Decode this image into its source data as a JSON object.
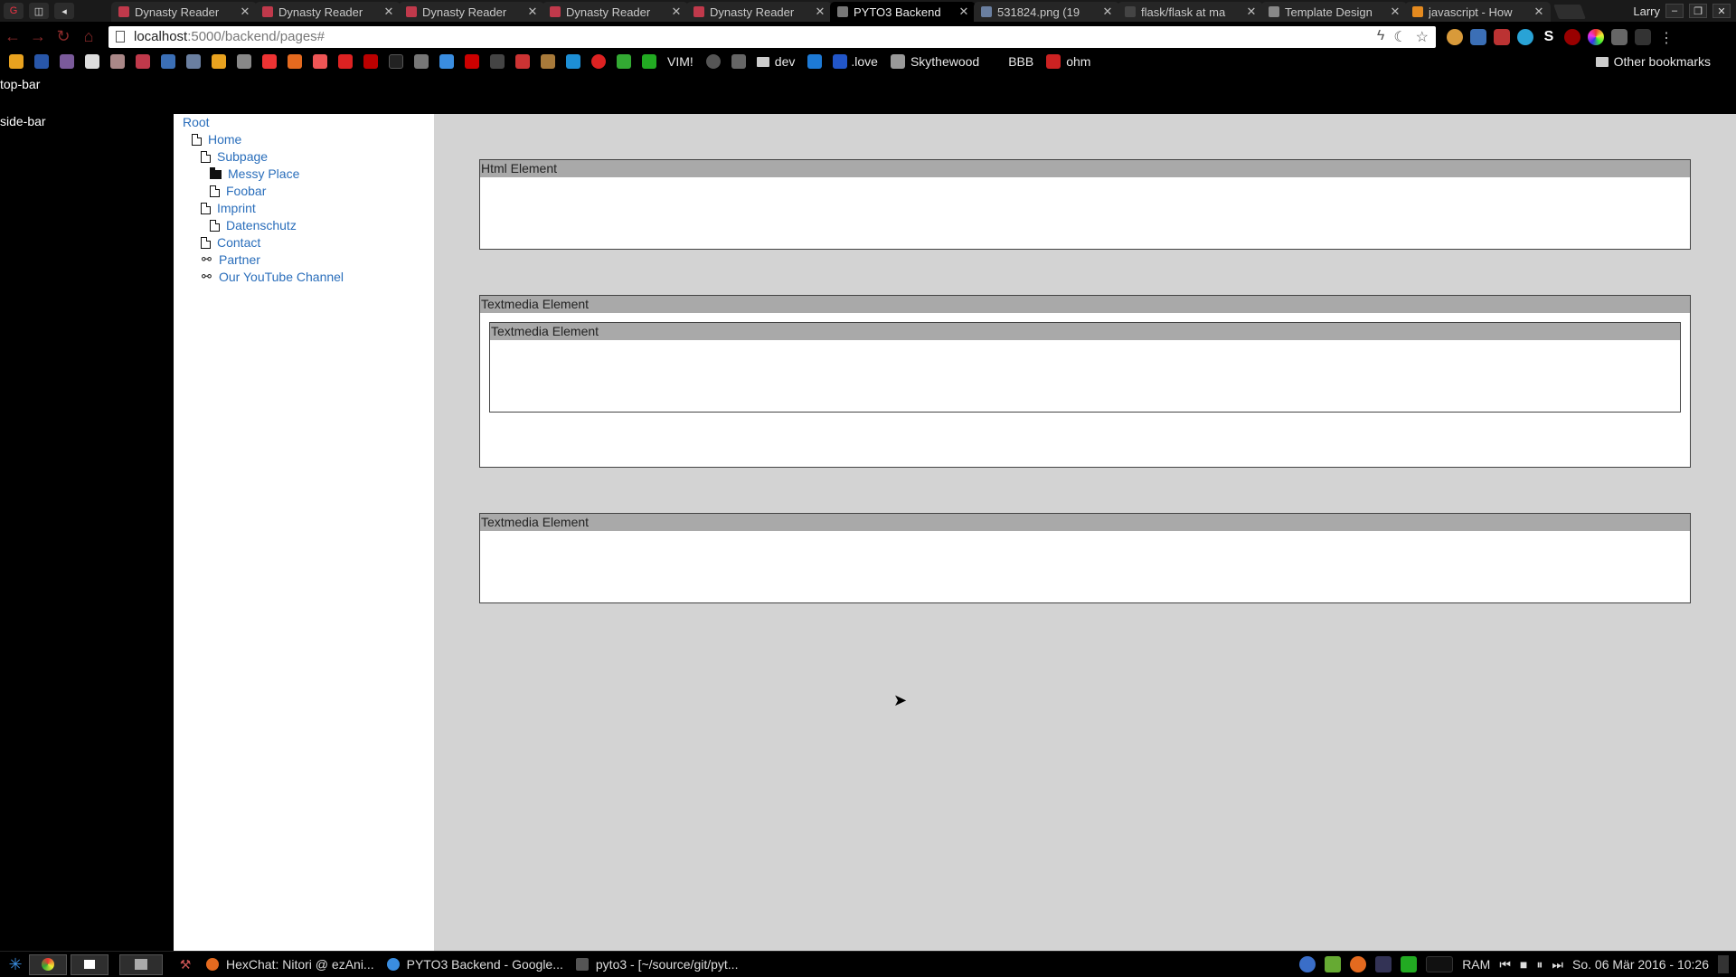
{
  "browser": {
    "tabs": [
      {
        "label": "Dynasty Reader",
        "fav_color": "#c0394b",
        "active": false
      },
      {
        "label": "Dynasty Reader",
        "fav_color": "#c0394b",
        "active": false
      },
      {
        "label": "Dynasty Reader",
        "fav_color": "#c0394b",
        "active": false
      },
      {
        "label": "Dynasty Reader",
        "fav_color": "#c0394b",
        "active": false
      },
      {
        "label": "Dynasty Reader",
        "fav_color": "#c0394b",
        "active": false
      },
      {
        "label": "PYTO3 Backend",
        "fav_color": "#777777",
        "active": true
      },
      {
        "label": "531824.png (19",
        "fav_color": "#6a7fa0",
        "active": false
      },
      {
        "label": "flask/flask at ma",
        "fav_color": "#444444",
        "active": false
      },
      {
        "label": "Template Design",
        "fav_color": "#888888",
        "active": false
      },
      {
        "label": "javascript - How",
        "fav_color": "#e48a1f",
        "active": false
      }
    ],
    "profile_name": "Larry",
    "url_host": "localhost",
    "url_path": ":5000/backend/pages#",
    "bookmarks": [
      {
        "label": "VIM!",
        "type": "link"
      },
      {
        "label": "dev",
        "type": "folder"
      },
      {
        "label": ".love",
        "type": "link"
      },
      {
        "label": "Skythewood",
        "type": "link"
      },
      {
        "label": "BBB",
        "type": "link"
      },
      {
        "label": "ohm",
        "type": "link"
      }
    ],
    "other_bookmarks": "Other bookmarks"
  },
  "page": {
    "top_bar_label": "top-bar",
    "side_bar_label": "side-bar",
    "tree": {
      "root": "Root",
      "items": [
        {
          "label": "Home",
          "icon": "page-icon",
          "depth": 1
        },
        {
          "label": "Subpage",
          "icon": "page-icon",
          "depth": 2
        },
        {
          "label": "Messy Place",
          "icon": "folder-icon",
          "depth": 3
        },
        {
          "label": "Foobar",
          "icon": "page-icon",
          "depth": 3
        },
        {
          "label": "Imprint",
          "icon": "page-icon",
          "depth": 2
        },
        {
          "label": "Datenschutz",
          "icon": "page-icon",
          "depth": 3
        },
        {
          "label": "Contact",
          "icon": "page-icon",
          "depth": 2
        },
        {
          "label": "Partner",
          "icon": "link-icon",
          "depth": 2
        },
        {
          "label": "Our YouTube Channel",
          "icon": "link-icon",
          "depth": 2
        }
      ]
    },
    "elements": [
      {
        "title": "Html Element"
      },
      {
        "title": "Textmedia Element",
        "child_title": "Textmedia Element"
      },
      {
        "title": "Textmedia Element"
      }
    ]
  },
  "taskbar": {
    "tasks": [
      {
        "label": "HexChat: Nitori @ ezAni...",
        "color": "#e46a1f"
      },
      {
        "label": "PYTO3 Backend - Google...",
        "color": "#3a8de0"
      },
      {
        "label": "pyto3 - [~/source/git/pyt...",
        "color": "#555555"
      }
    ],
    "ram_label": "RAM",
    "clock": "So. 06 Mär 2016 - 10:26"
  }
}
